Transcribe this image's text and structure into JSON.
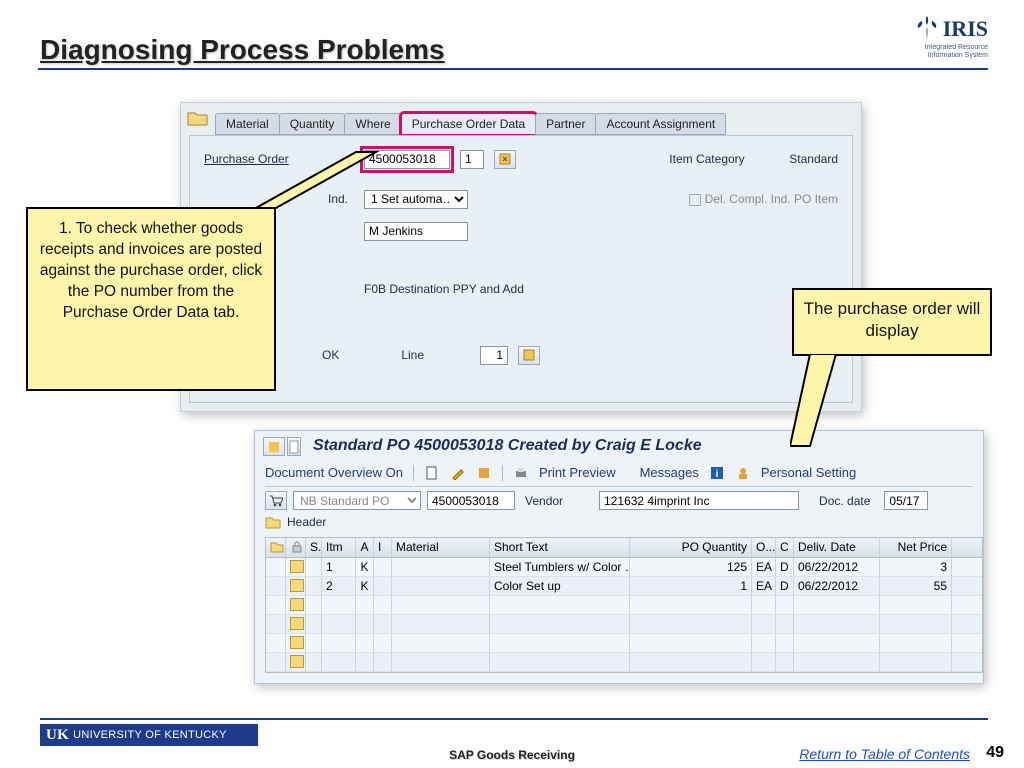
{
  "slide": {
    "title": "Diagnosing Process Problems",
    "footer_title": "SAP Goods Receiving",
    "toc_link": "Return to Table of Contents",
    "page_number": "49",
    "uk_badge": "UNIVERSITY OF KENTUCKY"
  },
  "logo": {
    "name": "IRIS",
    "sub1": "Integrated Resource",
    "sub2": "Information System"
  },
  "panel1": {
    "tabs": [
      "Material",
      "Quantity",
      "Where",
      "Purchase Order Data",
      "Partner",
      "Account Assignment"
    ],
    "po_label": "Purchase Order",
    "po_number": "4500053018",
    "po_item": "1",
    "item_cat_label": "Item Category",
    "item_cat_value": "Standard",
    "compl_ind_label": "Ind.",
    "compl_ind_value": "1 Set automa…",
    "del_compl_label": "Del. Compl. Ind. PO Item",
    "requisitioner": "M Jenkins",
    "fob_line": "F0B  Destination PPY and Add",
    "ok_label": "OK",
    "line_label": "Line",
    "line_value": "1"
  },
  "callouts": {
    "c1": "1. To check whether goods receipts and invoices are posted against the purchase order, click the PO number from the Purchase Order Data tab.",
    "c2": "The purchase order will display"
  },
  "panel2": {
    "title": "Standard PO 4500053018 Created by Craig E Locke",
    "toolbar": {
      "doc_overview": "Document Overview On",
      "print_preview": "Print Preview",
      "messages": "Messages",
      "personal_setting": "Personal Setting"
    },
    "doc_type": "NB Standard PO",
    "po_number": "4500053018",
    "vendor_label": "Vendor",
    "vendor_value": "121632 4imprint Inc",
    "doc_date_label": "Doc. date",
    "doc_date_value": "05/17",
    "header_label": "Header",
    "columns": {
      "s": "S..",
      "itm": "Itm",
      "a": "A",
      "i": "I",
      "mat": "Material",
      "st": "Short Text",
      "qty": "PO Quantity",
      "o": "O...",
      "c": "C",
      "dd": "Deliv. Date",
      "np": "Net Price"
    },
    "rows": [
      {
        "itm": "1",
        "a": "K",
        "st": "Steel Tumblers w/ Color …",
        "qty": "125",
        "o": "EA",
        "c": "D",
        "dd": "06/22/2012",
        "np": "3"
      },
      {
        "itm": "2",
        "a": "K",
        "st": "Color Set up",
        "qty": "1",
        "o": "EA",
        "c": "D",
        "dd": "06/22/2012",
        "np": "55"
      }
    ]
  }
}
